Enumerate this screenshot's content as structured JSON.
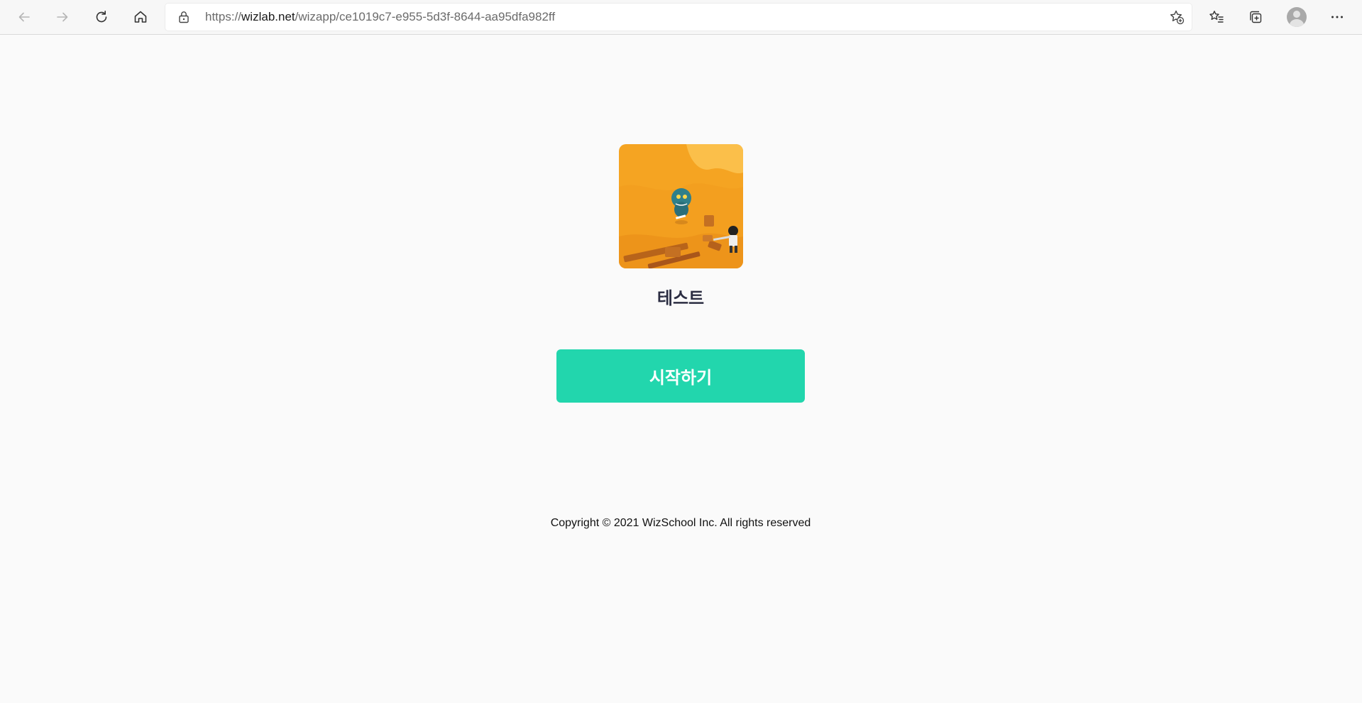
{
  "browser": {
    "url_scheme": "https://",
    "url_host": "wizlab.net",
    "url_path": "/wizapp/ce1019c7-e955-5d3f-8644-aa95dfa982ff",
    "icons": [
      "back-icon",
      "forward-icon",
      "refresh-icon",
      "home-icon",
      "lock-icon",
      "add-favorite-icon",
      "favorites-icon",
      "collections-icon",
      "profile-avatar",
      "more-icon"
    ]
  },
  "app": {
    "title": "테스트",
    "start_label": "시작하기",
    "thumbnail_alt": "테스트",
    "accent_color": "#22d6ad",
    "thumbnail_bg_color": "#f6a623"
  },
  "footer": {
    "copyright": "Copyright © 2021 WizSchool Inc. All rights reserved"
  }
}
